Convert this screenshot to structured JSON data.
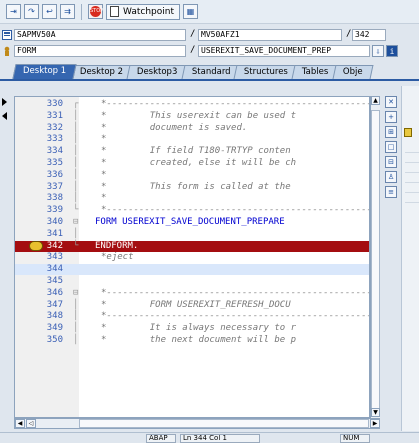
{
  "toolbar": {
    "watchpoint_label": "Watchpoint"
  },
  "info": {
    "program": "SAPMV50A",
    "include": "MV50AFZ1",
    "line": "342",
    "type": "FORM",
    "name": "USEREXIT_SAVE_DOCUMENT_PREP"
  },
  "tabs": [
    {
      "label": "Desktop 1",
      "active": true
    },
    {
      "label": "Desktop 2",
      "active": false
    },
    {
      "label": "Desktop3",
      "active": false
    },
    {
      "label": "Standard",
      "active": false
    },
    {
      "label": "Structures",
      "active": false
    },
    {
      "label": "Tables",
      "active": false
    },
    {
      "label": "Obje",
      "active": false
    }
  ],
  "code_lines": [
    {
      "no": "330",
      "text": "*---------------------------------------------------------------",
      "style": "comment",
      "fold": "┌"
    },
    {
      "no": "331",
      "text": "*        This userexit can be used t",
      "style": "comment",
      "fold": "│"
    },
    {
      "no": "332",
      "text": "*        document is saved.",
      "style": "comment",
      "fold": "│"
    },
    {
      "no": "333",
      "text": "*",
      "style": "comment",
      "fold": "│"
    },
    {
      "no": "334",
      "text": "*        If field T180-TRTYP conten",
      "style": "comment",
      "fold": "│"
    },
    {
      "no": "335",
      "text": "*        created, else it will be ch",
      "style": "comment",
      "fold": "│"
    },
    {
      "no": "336",
      "text": "*",
      "style": "comment",
      "fold": "│"
    },
    {
      "no": "337",
      "text": "*        This form is called at the",
      "style": "comment",
      "fold": "│"
    },
    {
      "no": "338",
      "text": "*",
      "style": "comment",
      "fold": "│"
    },
    {
      "no": "339",
      "text": "*---------------------------------------------------------------",
      "style": "comment",
      "fold": "└"
    },
    {
      "no": "340",
      "text": "FORM USEREXIT_SAVE_DOCUMENT_PREPARE",
      "style": "keyword",
      "fold": "⊟"
    },
    {
      "no": "341",
      "text": "",
      "style": "plain",
      "fold": "│"
    },
    {
      "no": "342",
      "text": "ENDFORM.",
      "style": "highlight",
      "fold": "└"
    },
    {
      "no": "343",
      "text": "*eject",
      "style": "comment",
      "fold": ""
    },
    {
      "no": "344",
      "text": "",
      "style": "current",
      "fold": ""
    },
    {
      "no": "345",
      "text": "",
      "style": "plain",
      "fold": ""
    },
    {
      "no": "346",
      "text": "*---------------------------------------------------------------",
      "style": "comment",
      "fold": "⊟"
    },
    {
      "no": "347",
      "text": "*        FORM USEREXIT_REFRESH_DOCU",
      "style": "comment",
      "fold": "│"
    },
    {
      "no": "348",
      "text": "*---------------------------------------------------------------",
      "style": "comment",
      "fold": "│"
    },
    {
      "no": "349",
      "text": "*        It is always necessary to r",
      "style": "comment",
      "fold": "│"
    },
    {
      "no": "350",
      "text": "*        the next document will be p",
      "style": "comment",
      "fold": "│"
    }
  ],
  "status": {
    "mode": "ABAP",
    "position": "Ln 344 Col 1",
    "insert": "NUM"
  },
  "colors": {
    "highlight": "#a40d10",
    "accent": "#3566b0"
  }
}
